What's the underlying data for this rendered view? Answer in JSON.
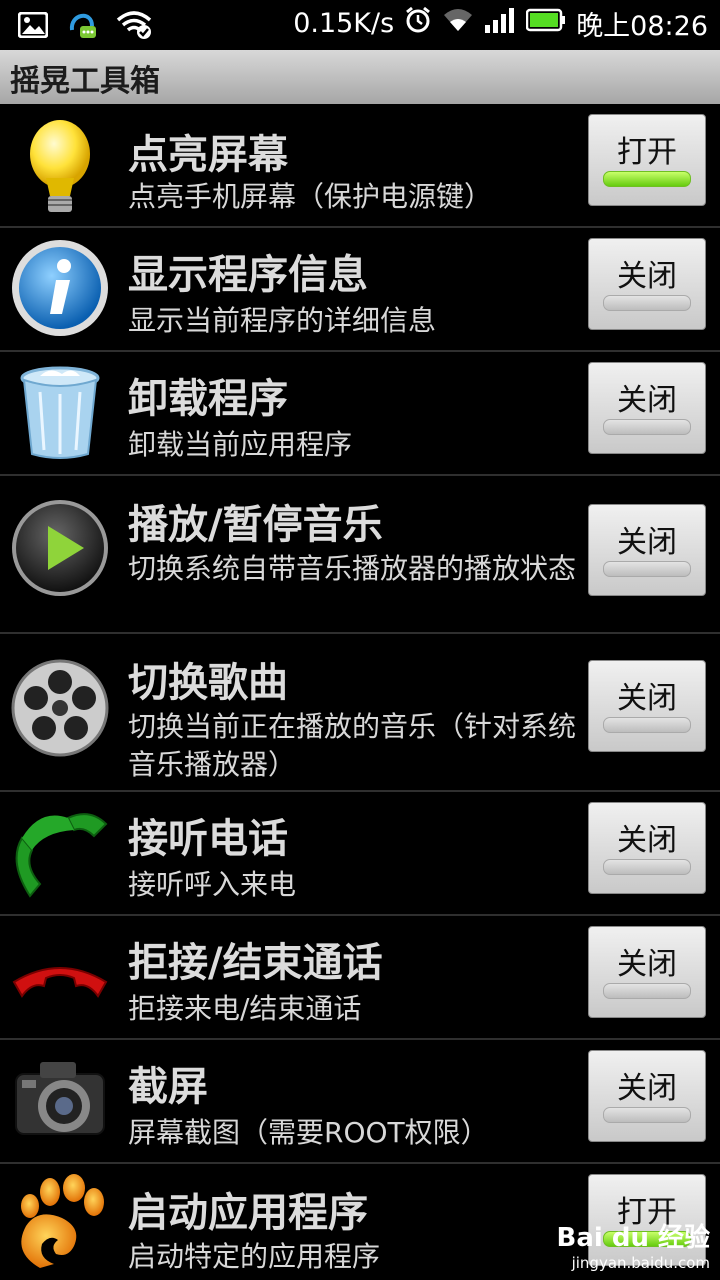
{
  "status": {
    "speed": "0.15K/s",
    "time": "晚上08:26"
  },
  "app": {
    "title": "摇晃工具箱"
  },
  "items": [
    {
      "title": "点亮屏幕",
      "desc": "点亮手机屏幕（保护电源键）",
      "toggle": "打开",
      "on": true
    },
    {
      "title": "显示程序信息",
      "desc": "显示当前程序的详细信息",
      "toggle": "关闭",
      "on": false
    },
    {
      "title": "卸载程序",
      "desc": "卸载当前应用程序",
      "toggle": "关闭",
      "on": false
    },
    {
      "title": "播放/暂停音乐",
      "desc": "切换系统自带音乐播放器的播放状态",
      "toggle": "关闭",
      "on": false
    },
    {
      "title": "切换歌曲",
      "desc": "切换当前正在播放的音乐（针对系统音乐播放器）",
      "toggle": "关闭",
      "on": false
    },
    {
      "title": "接听电话",
      "desc": "接听呼入来电",
      "toggle": "关闭",
      "on": false
    },
    {
      "title": "拒接/结束通话",
      "desc": "拒接来电/结束通话",
      "toggle": "关闭",
      "on": false
    },
    {
      "title": "截屏",
      "desc": "屏幕截图（需要ROOT权限）",
      "toggle": "关闭",
      "on": false
    },
    {
      "title": "启动应用程序",
      "desc": "启动特定的应用程序",
      "toggle": "打开",
      "on": true
    }
  ],
  "watermark": {
    "brand": "Bai du 经验",
    "url": "jingyan.baidu.com"
  }
}
